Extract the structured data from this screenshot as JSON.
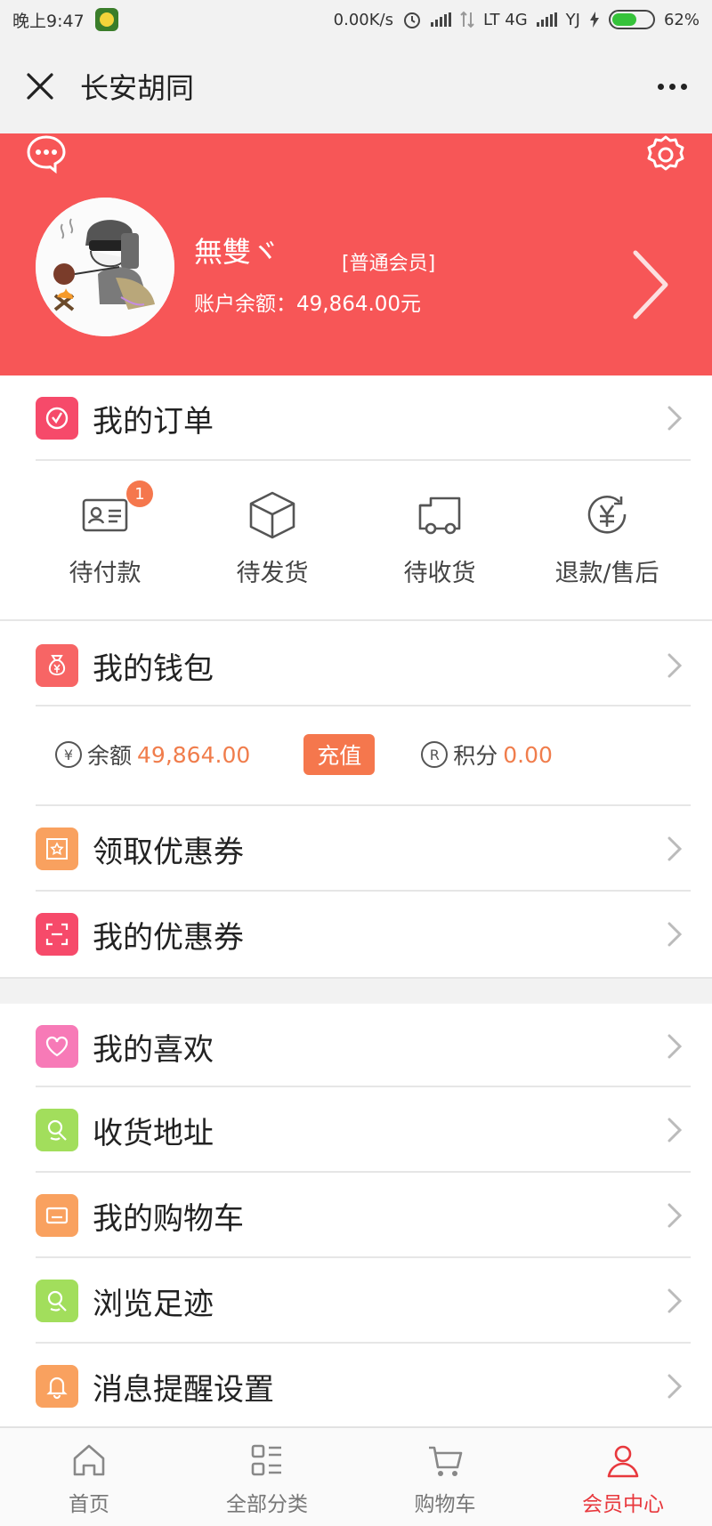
{
  "status_bar": {
    "time": "晚上9:47",
    "net_speed": "0.00K/s",
    "carrier1": "LT 4G",
    "carrier2": "YJ",
    "battery": "62%",
    "battery_level": 0.62
  },
  "header": {
    "title": "长安胡同"
  },
  "profile": {
    "username": "無雙ヾ",
    "member_level": "[普通会员]",
    "balance_text": "账户余额：49,864.00元",
    "banner_color": "#f75657"
  },
  "orders": {
    "title": "我的订单",
    "items": [
      {
        "label": "待付款",
        "badge": "1"
      },
      {
        "label": "待发货"
      },
      {
        "label": "待收货"
      },
      {
        "label": "退款/售后"
      }
    ]
  },
  "wallet": {
    "title": "我的钱包",
    "balance_label": "余额",
    "balance_value": "49,864.00",
    "recharge_label": "充值",
    "points_label": "积分",
    "points_value": "0.00",
    "yen_glyph": "¥",
    "points_glyph": "R"
  },
  "menu1": [
    {
      "label": "领取优惠券",
      "color": "#f9a15f"
    },
    {
      "label": "我的优惠券",
      "color": "#f64a6a"
    }
  ],
  "menu2": [
    {
      "label": "我的喜欢",
      "color": "#f77ab7"
    },
    {
      "label": "收货地址",
      "color": "#a2de5c"
    },
    {
      "label": "我的购物车",
      "color": "#f9a15f"
    },
    {
      "label": "浏览足迹",
      "color": "#a2de5c"
    },
    {
      "label": "消息提醒设置",
      "color": "#f9a15f"
    }
  ],
  "bottom_nav": [
    {
      "label": "首页"
    },
    {
      "label": "全部分类"
    },
    {
      "label": "购物车"
    },
    {
      "label": "会员中心",
      "active": true
    }
  ],
  "accent_color": "#f5774d"
}
